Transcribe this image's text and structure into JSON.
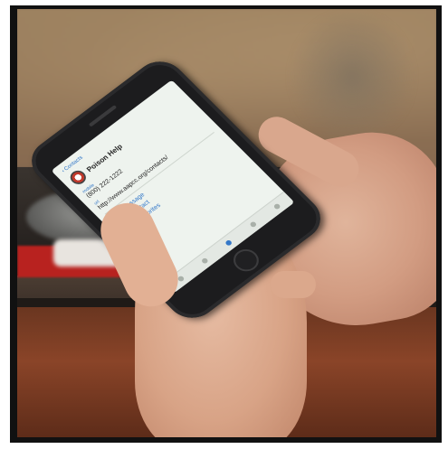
{
  "phone_screen": {
    "back_label": "‹ Contacts",
    "contact_name": "Poison Help",
    "phone_label": "mobile",
    "phone_value": "(800) 222-1222",
    "url_label": "url",
    "url_value": "http://www.aapcc.org/contacts/",
    "actions": [
      "Send Message",
      "Share Contact",
      "Add to Favorites"
    ]
  },
  "colors": {
    "link_blue": "#3478c8",
    "towel_red": "#b8221f",
    "counter_wood": "#8a4428"
  }
}
